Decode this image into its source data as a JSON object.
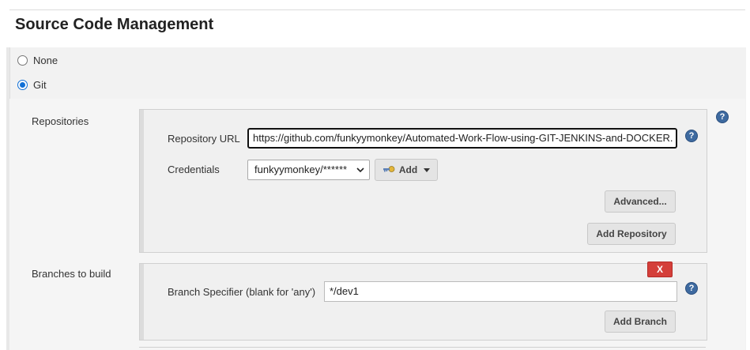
{
  "section": {
    "title": "Source Code Management"
  },
  "scm_options": [
    {
      "label": "None",
      "selected": false
    },
    {
      "label": "Git",
      "selected": true
    }
  ],
  "repositories": {
    "label": "Repositories",
    "url_label": "Repository URL",
    "url_value": "https://github.com/funkyymonkey/Automated-Work-Flow-using-GIT-JENKINS-and-DOCKER.",
    "credentials_label": "Credentials",
    "credentials_value": "funkyymonkey/******",
    "add_label": "Add",
    "advanced_label": "Advanced...",
    "add_repository_label": "Add Repository"
  },
  "branches": {
    "label": "Branches to build",
    "delete_label": "X",
    "specifier_label": "Branch Specifier (blank for 'any')",
    "specifier_value": "*/dev1",
    "add_branch_label": "Add Branch"
  },
  "help_glyph": "?",
  "icons": [
    "help-icon",
    "key-icon",
    "chevron-down-icon",
    "caret-down-icon"
  ],
  "colors": {
    "help": "#3e6aa0",
    "delete": "#d43f3a",
    "radio_selected": "#0f6fd6"
  }
}
